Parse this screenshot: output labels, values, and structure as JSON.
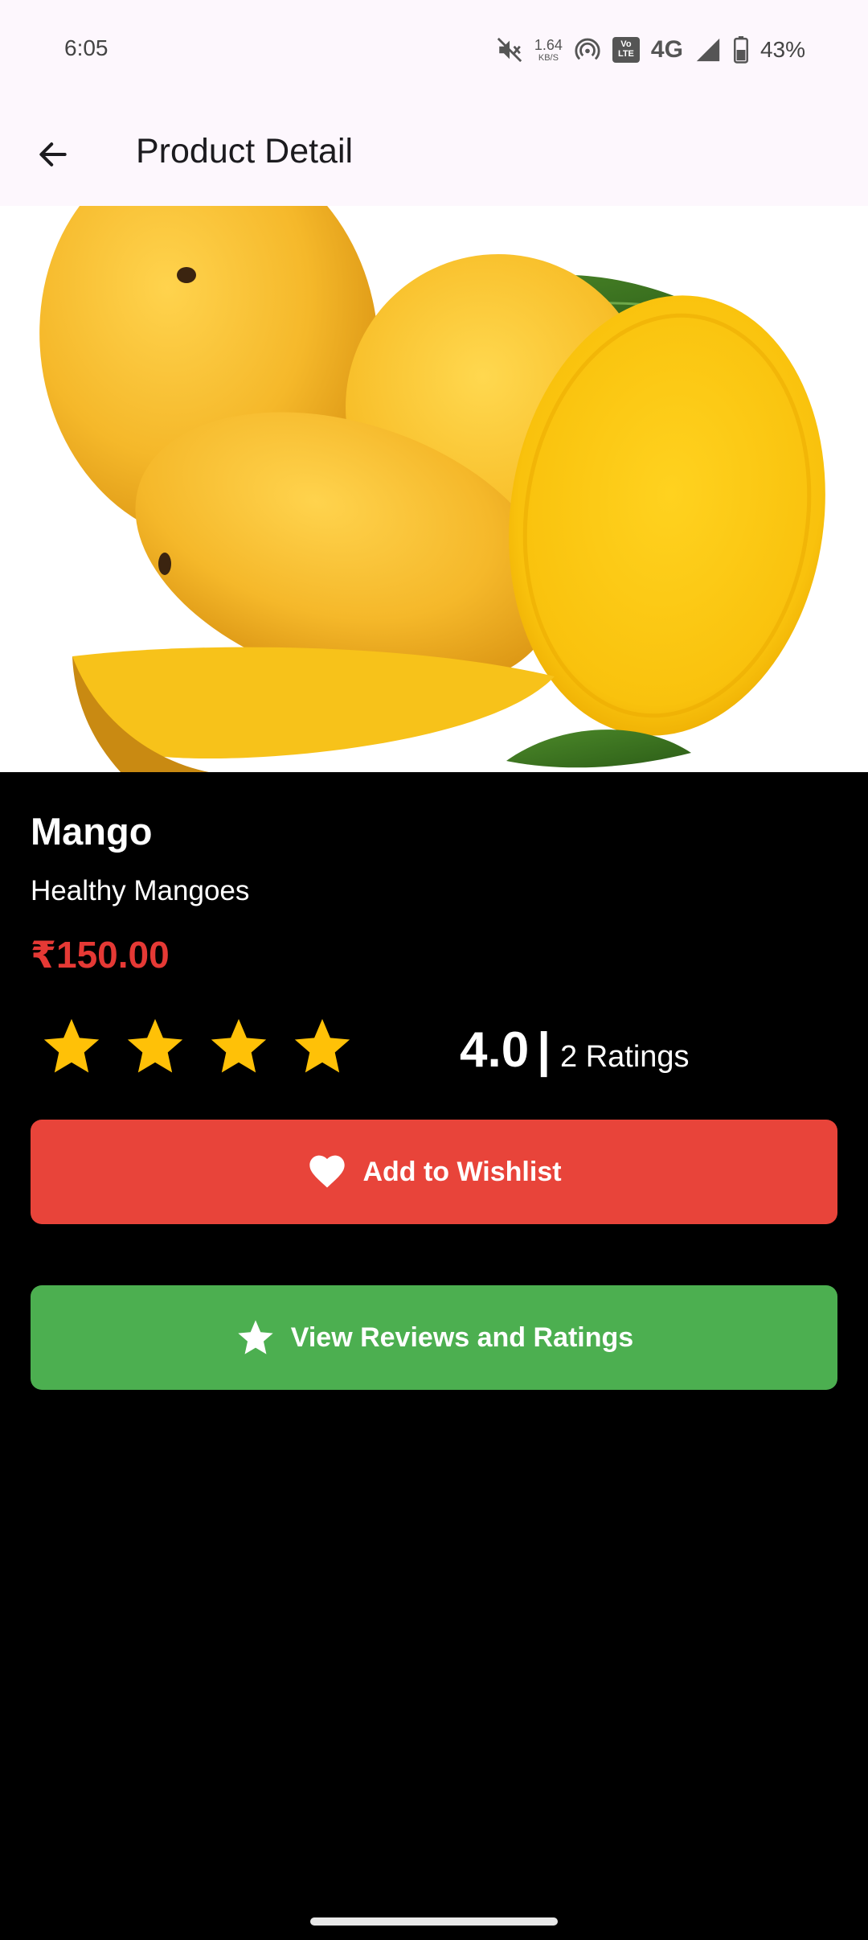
{
  "status_bar": {
    "time": "6:05",
    "speed_value": "1.64",
    "speed_unit": "KB/S",
    "volte_top": "Vo",
    "volte_bottom": "LTE",
    "network": "4G",
    "battery": "43%"
  },
  "app_bar": {
    "title": "Product Detail"
  },
  "product": {
    "name": "Mango",
    "description": "Healthy Mangoes",
    "price": "₹150.00",
    "stars_filled": 4,
    "rating_value": "4.0",
    "rating_separator": "|",
    "rating_count": "2 Ratings"
  },
  "actions": {
    "wishlist_label": "Add to Wishlist",
    "reviews_label": "View Reviews and Ratings"
  },
  "colors": {
    "price": "#e53935",
    "star": "#ffc107",
    "wishlist_button": "#e8443a",
    "reviews_button": "#4caf50"
  }
}
